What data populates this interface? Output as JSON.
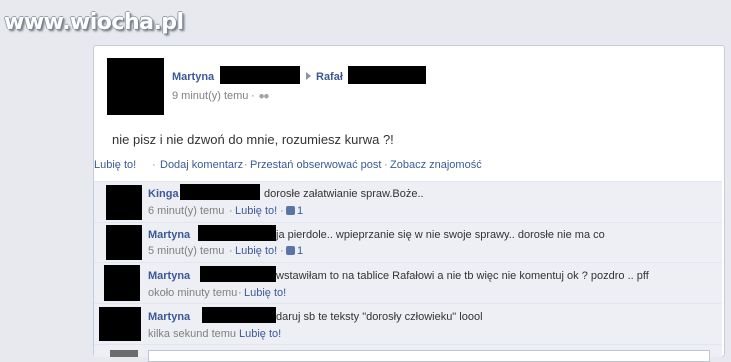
{
  "watermark": "www.wiocha.pl",
  "post": {
    "author": "Martyna",
    "recipient": "Rafał",
    "time": "9 minut(y) temu",
    "dot": "·",
    "message": "nie pisz i nie dzwoń do mnie, rozumiesz kurwa ?!"
  },
  "actions": {
    "like": "Lubię to!",
    "comment": "Dodaj komentarz",
    "unfollow": "Przestań obserwować post",
    "friendship": "Zobacz znajomość",
    "separator": "·"
  },
  "comments": [
    {
      "author": "Kinga",
      "text": "dorosłe załatwianie spraw.Boże..",
      "time": "6 minut(y) temu",
      "like": "Lubię to!",
      "likes": "1"
    },
    {
      "author": "Martyna",
      "text": "ja pierdole.. wpieprzanie się w nie swoje sprawy.. dorosłe nie ma co",
      "time": "5 minut(y) temu",
      "like": "Lubię to!",
      "likes": "1"
    },
    {
      "author": "Martyna",
      "text": "wstawiłam to na tablice Rafałowi a nie tb więc nie komentuj ok ? pozdro .. pff",
      "time": "około minuty temu",
      "like": "Lubię to!",
      "likes": ""
    },
    {
      "author": "Martyna",
      "text": "daruj sb te teksty \"dorosły człowieku\" loool",
      "time": "kilka sekund temu",
      "like": "Lubię to!",
      "likes": ""
    }
  ],
  "icons": {
    "audience": "people-icon",
    "arrow": "play-icon",
    "like": "thumbs-up-icon"
  }
}
